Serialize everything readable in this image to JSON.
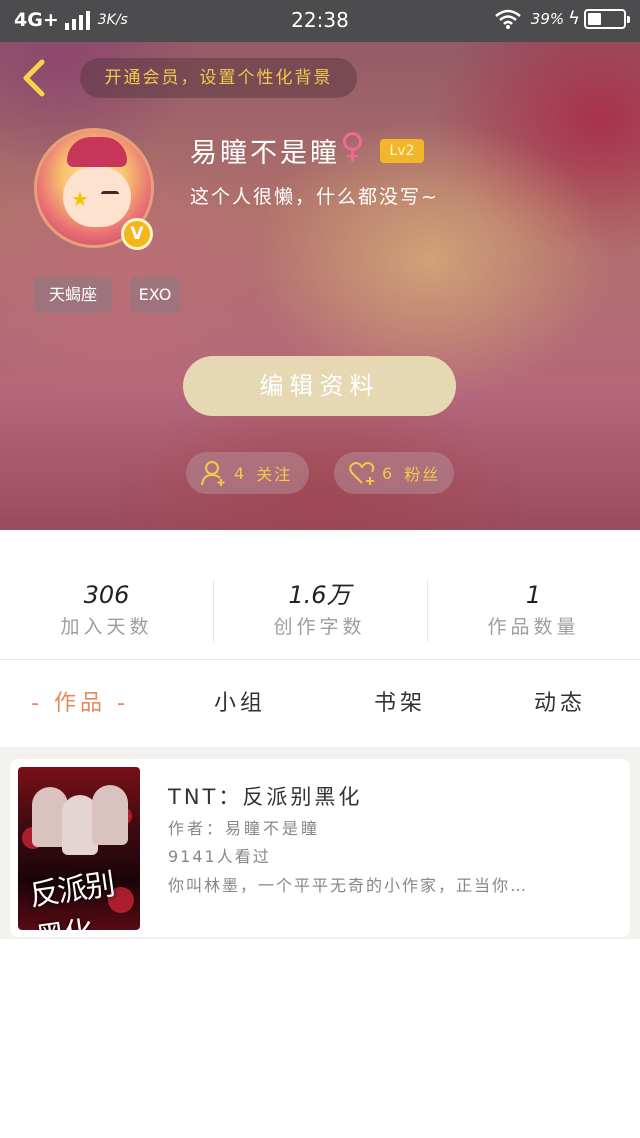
{
  "status_bar": {
    "network": "4G+",
    "speed": "3K/s",
    "time": "22:38",
    "battery_percent": "39%",
    "battery_level": 0.39
  },
  "header": {
    "back_icon": "chevron-left-icon",
    "vip_banner": "开通会员，设置个性化背景",
    "username": "易瞳不是瞳",
    "gender_icon": "female-icon",
    "level": "Lv2",
    "bio": "这个人很懒，什么都没写~",
    "tags": [
      "天蝎座",
      "EXO"
    ],
    "edit_button": "编辑资料",
    "following": {
      "count": "4",
      "label": "关注"
    },
    "fans": {
      "count": "6",
      "label": "粉丝"
    }
  },
  "stats": [
    {
      "value": "306",
      "label": "加入天数"
    },
    {
      "value": "1.6万",
      "label": "创作字数"
    },
    {
      "value": "1",
      "label": "作品数量"
    }
  ],
  "tabs": [
    {
      "label": "- 作品 -",
      "active": true
    },
    {
      "label": "小组",
      "active": false
    },
    {
      "label": "书架",
      "active": false
    },
    {
      "label": "动态",
      "active": false
    }
  ],
  "works": [
    {
      "title": "TNT：反派别黑化",
      "author": "作者：易瞳不是瞳",
      "views": "9141人看过",
      "desc": "你叫林墨，一个平平无奇的小作家，正当你…",
      "cover_title": "反派别黑化"
    }
  ],
  "colors": {
    "accent_orange": "#e38a5a",
    "gold": "#f2c94c",
    "level_badge": "#f2b62b",
    "edit_button": "#e7d8b4"
  }
}
